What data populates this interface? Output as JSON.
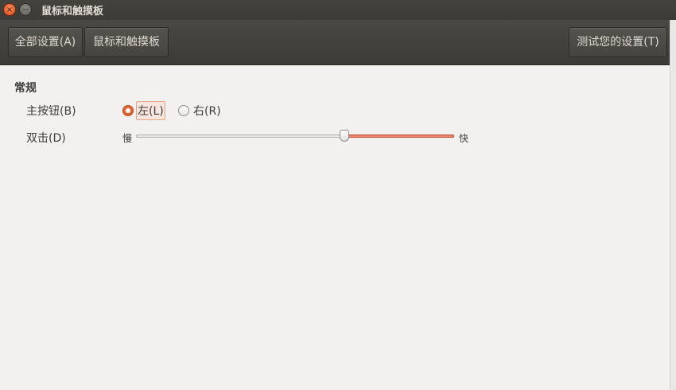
{
  "window": {
    "title": "鼠标和触摸板",
    "close_glyph": "×",
    "minimize_glyph": "−"
  },
  "toolbar": {
    "all_settings_label": "全部设置(A)",
    "current_label": "鼠标和触摸板",
    "test_settings_label": "测试您的设置(T)"
  },
  "general": {
    "section_title": "常规",
    "primary_button": {
      "label": "主按钮(B)",
      "options": [
        {
          "label": "左(L)",
          "selected": true
        },
        {
          "label": "右(R)",
          "selected": false
        }
      ]
    },
    "double_click": {
      "label": "双击(D)",
      "min_label": "慢",
      "max_label": "快",
      "value": 0.66
    }
  },
  "colors": {
    "titlebar": "#3c3b37",
    "accent": "#dd4814",
    "background": "#f2f1f0"
  }
}
